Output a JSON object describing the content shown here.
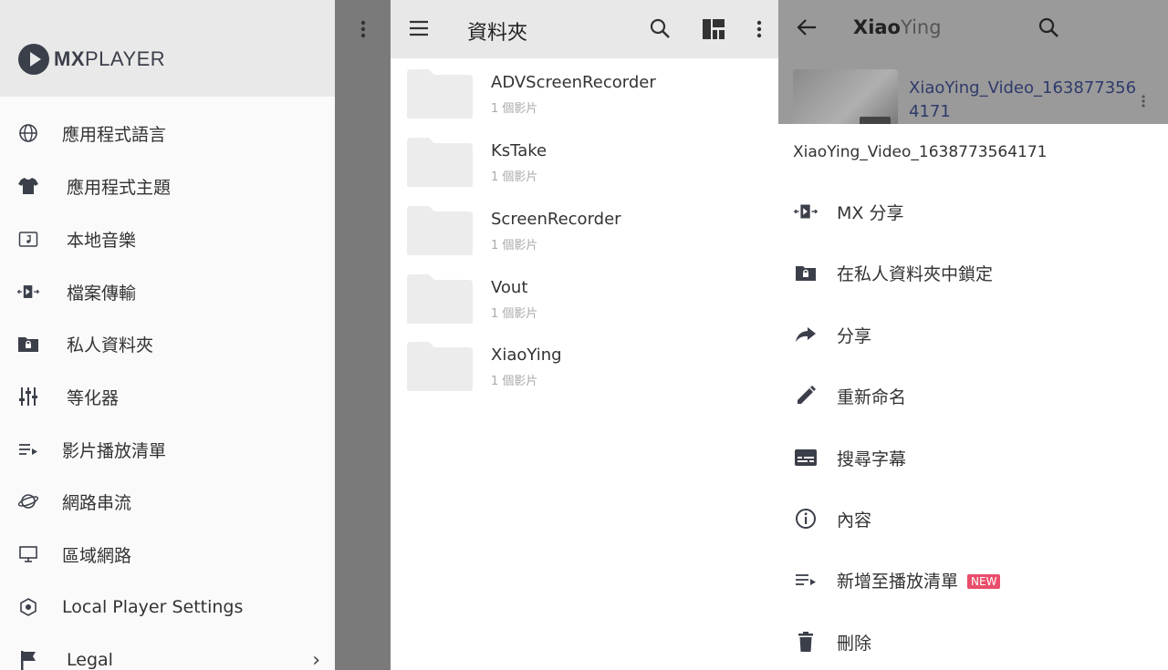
{
  "drawer": {
    "logo": {
      "bold": "MX",
      "light": "PLAYER"
    },
    "items": [
      {
        "label": "應用程式語言",
        "icon": "globe-icon"
      },
      {
        "label": "應用程式主題",
        "icon": "shirt-icon"
      },
      {
        "label": "本地音樂",
        "icon": "music-folder-icon"
      },
      {
        "label": "檔案傳輸",
        "icon": "file-transfer-icon"
      },
      {
        "label": "私人資料夾",
        "icon": "lock-folder-icon"
      },
      {
        "label": "等化器",
        "icon": "equalizer-icon"
      },
      {
        "label": "影片播放清單",
        "icon": "playlist-icon"
      },
      {
        "label": "網路串流",
        "icon": "network-stream-icon"
      },
      {
        "label": "區域網路",
        "icon": "lan-icon"
      },
      {
        "label": "Local Player Settings",
        "icon": "settings-hex-icon"
      },
      {
        "label": "Legal",
        "icon": "flag-icon"
      }
    ]
  },
  "folders_view": {
    "title": "資料夾",
    "folders": [
      {
        "name": "ADVScreenRecorder",
        "count": "1 個影片"
      },
      {
        "name": "KsTake",
        "count": "1 個影片"
      },
      {
        "name": "ScreenRecorder",
        "count": "1 個影片"
      },
      {
        "name": "Vout",
        "count": "1 個影片"
      },
      {
        "name": "XiaoYing",
        "count": "1 個影片"
      }
    ]
  },
  "context": {
    "folder_title_bold": "Xiao",
    "folder_title_light": "Ying",
    "video_title": "XiaoYing_Video_1638773564171",
    "sheet_title": "XiaoYing_Video_1638773564171",
    "actions": [
      {
        "label": "MX 分享",
        "icon": "mx-share-icon"
      },
      {
        "label": "在私人資料夾中鎖定",
        "icon": "lock-folder-icon"
      },
      {
        "label": "分享",
        "icon": "share-arrow-icon"
      },
      {
        "label": "重新命名",
        "icon": "pencil-icon"
      },
      {
        "label": "搜尋字幕",
        "icon": "subtitle-icon"
      },
      {
        "label": "內容",
        "icon": "info-icon"
      },
      {
        "label": "新增至播放清單",
        "icon": "playlist-add-icon",
        "badge": "NEW"
      },
      {
        "label": "刪除",
        "icon": "trash-icon"
      }
    ]
  },
  "colors": {
    "accent_badge": "#e94e6a",
    "link_title": "#2f3a6b",
    "icon_dark": "#3b3f4a"
  }
}
